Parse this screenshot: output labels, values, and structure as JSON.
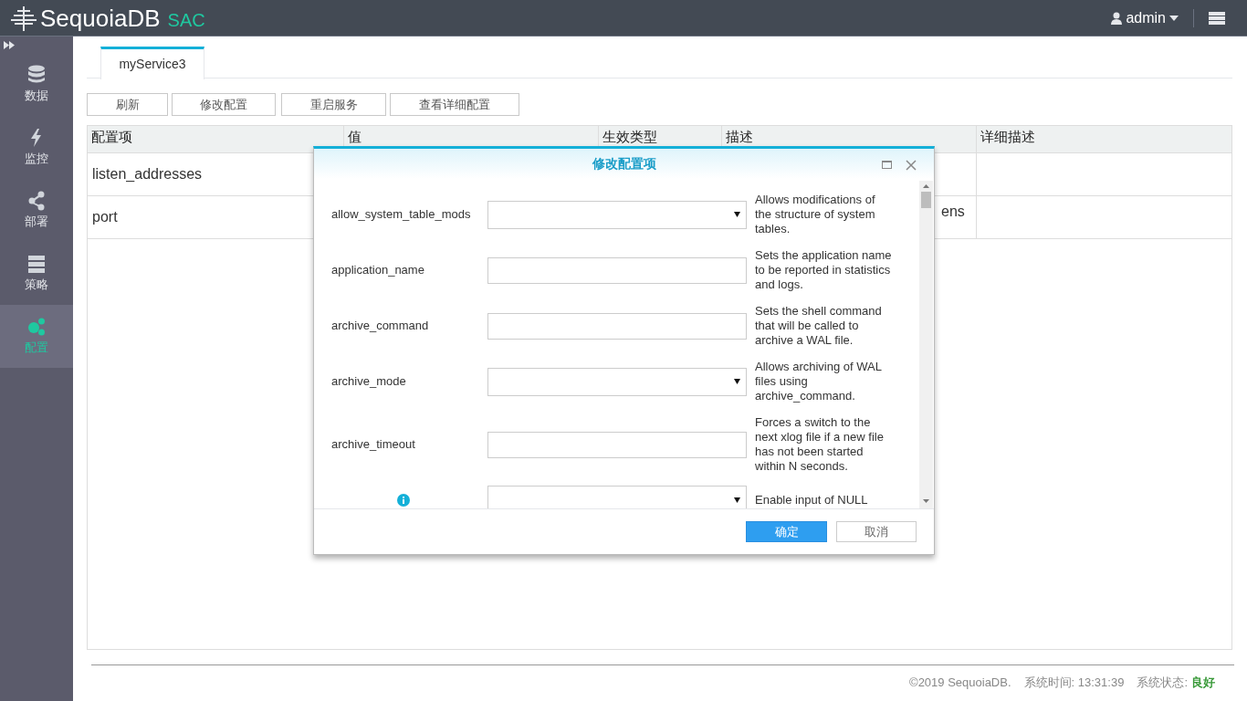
{
  "header": {
    "logo": "SequoiaDB",
    "product": "SAC",
    "user": "admin"
  },
  "sidebar": {
    "items": [
      {
        "label": "数据",
        "selected": false
      },
      {
        "label": "监控",
        "selected": false
      },
      {
        "label": "部署",
        "selected": false
      },
      {
        "label": "策略",
        "selected": false
      },
      {
        "label": "配置",
        "selected": true
      }
    ]
  },
  "tabs": [
    {
      "label": "myService3",
      "selected": true
    }
  ],
  "toolbar": [
    "刷新",
    "修改配置",
    "重启服务",
    "查看详细配置"
  ],
  "table": {
    "columns": [
      "配置项",
      "值",
      "生效类型",
      "描述",
      "详细描述"
    ],
    "rows": [
      {
        "name": "listen_addresses"
      },
      {
        "name": "port",
        "description": "ens"
      }
    ]
  },
  "dialog": {
    "title": "修改配置项",
    "fields": [
      {
        "label": "allow_system_table_mods",
        "kind": "select",
        "description": "Allows modifications of the structure of system tables."
      },
      {
        "label": "application_name",
        "kind": "text",
        "description": "Sets the application name to be reported in statistics and logs."
      },
      {
        "label": "archive_command",
        "kind": "text",
        "description": "Sets the shell command that will be called to archive a WAL file."
      },
      {
        "label": "archive_mode",
        "kind": "select",
        "description": "Allows archiving of WAL files using archive_command."
      },
      {
        "label": "archive_timeout",
        "kind": "text",
        "description": "Forces a switch to the next xlog file if a new file has not been started within N seconds."
      },
      {
        "kind": "select",
        "info": true,
        "description": "Enable input of NULL"
      }
    ],
    "buttons": {
      "ok": "确定",
      "cancel": "取消"
    }
  },
  "footer": {
    "copyright": "©2019 SequoiaDB.",
    "time": "系统时间: 13:31:39",
    "status_label": "系统状态:",
    "status": "良好"
  }
}
